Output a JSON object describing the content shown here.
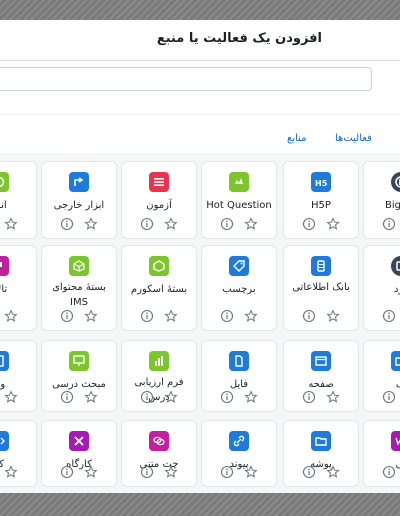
{
  "modal": {
    "title": "افزودن یک فعالیت یا منبع",
    "search_placeholder": "",
    "tabs": {
      "activities": "فعالیت‌ها",
      "resources": "منابع"
    }
  },
  "colors": {
    "activity_green": "#7cc62c",
    "assessment_red": "#e8344e",
    "content_blue": "#1f7bd9",
    "collaboration_purple": "#a51cb5",
    "communication_magenta": "#c41fa0",
    "interactive_blue": "#3e7fd6",
    "dark_slate": "#3a4558",
    "star_outline": "#6a737b",
    "info_outline": "#6a737b"
  },
  "rows": [
    [
      {
        "label": "BigBlu",
        "icon": "bigbluebutton-icon",
        "color": "#3a4558"
      },
      {
        "label": "H5P",
        "icon": "h5p-icon",
        "color": "#1f7bd9"
      },
      {
        "label": "Hot Question",
        "icon": "hot-question-icon",
        "color": "#7cc62c"
      },
      {
        "label": "آزمون",
        "icon": "quiz-icon",
        "color": "#e8344e"
      },
      {
        "label": "ابزار خارجی",
        "icon": "external-tool-icon",
        "color": "#1f7bd9"
      },
      {
        "label": "انت",
        "icon": "choice-icon",
        "color": "#7cc62c"
      }
    ],
    [
      {
        "label": "ورد",
        "icon": "board-icon",
        "color": "#3a4558"
      },
      {
        "label": "بانک اطلاعاتی",
        "icon": "database-icon",
        "color": "#1f7bd9"
      },
      {
        "label": "برچسب",
        "icon": "label-tag-icon",
        "color": "#1f7bd9"
      },
      {
        "label": "بستهٔ اسکورم",
        "icon": "scorm-package-icon",
        "color": "#7cc62c"
      },
      {
        "label": "بستهٔ محتوای IMS",
        "icon": "ims-package-icon",
        "color": "#7cc62c"
      },
      {
        "label": "تالار",
        "icon": "forum-icon",
        "color": "#c41fa0"
      }
    ],
    [
      {
        "label": "ف",
        "icon": "folder-icon",
        "color": "#1f7bd9"
      },
      {
        "label": "صفحه",
        "icon": "page-icon",
        "color": "#1f7bd9"
      },
      {
        "label": "فایل",
        "icon": "file-icon",
        "color": "#1f7bd9"
      },
      {
        "label": "فرم ارزیابی درس",
        "icon": "feedback-form-icon",
        "color": "#7cc62c"
      },
      {
        "label": "مبحث درسی",
        "icon": "lesson-icon",
        "color": "#7cc62c"
      },
      {
        "label": "واژ",
        "icon": "glossary-icon",
        "color": "#1f7bd9"
      }
    ],
    [
      {
        "label": "نی",
        "icon": "wiki-icon",
        "color": "#a51cb5"
      },
      {
        "label": "پوشه",
        "icon": "folder-icon",
        "color": "#1f7bd9"
      },
      {
        "label": "پیوند",
        "icon": "url-link-icon",
        "color": "#1f7bd9"
      },
      {
        "label": "چت متنی",
        "icon": "chat-icon",
        "color": "#c41fa0"
      },
      {
        "label": "کارگاه",
        "icon": "workshop-icon",
        "color": "#a51cb5"
      },
      {
        "label": "کد",
        "icon": "code-icon",
        "color": "#1f7bd9"
      }
    ]
  ]
}
